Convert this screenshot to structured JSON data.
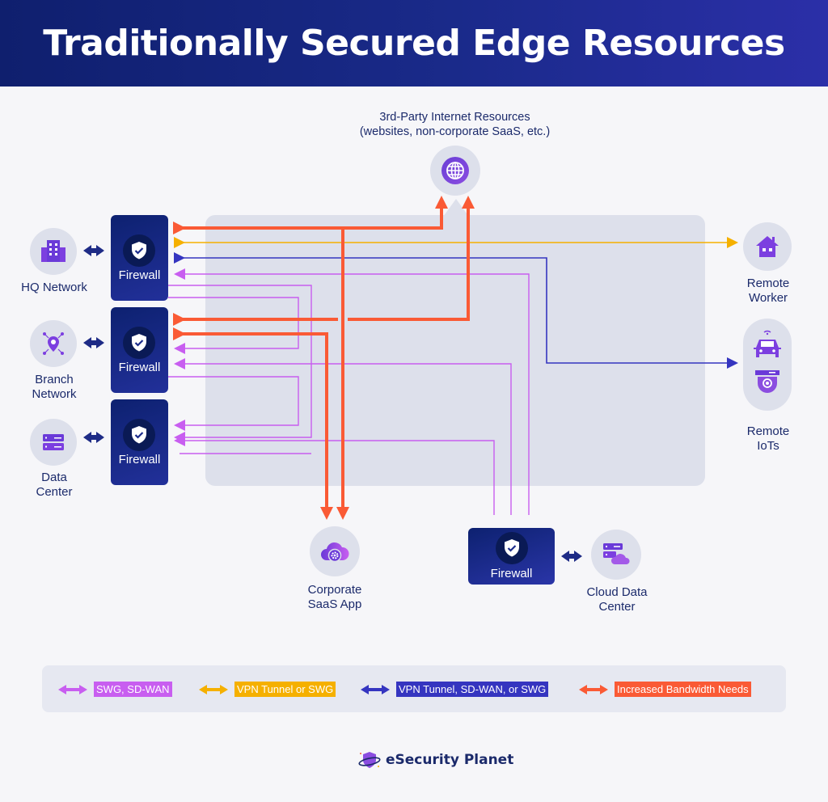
{
  "header": {
    "title": "Traditionally Secured Edge Resources"
  },
  "colors": {
    "swg_sdwan": "#c85ef0",
    "vpn_or_swg": "#f5b000",
    "vpn_sdwan_swg": "#3535c0",
    "increased_bandwidth": "#fa5a35",
    "firewall_bg": "#142584",
    "node_bg": "#dde0eb"
  },
  "internet": {
    "label_line1": "3rd-Party Internet Resources",
    "label_line2": "(websites, non-corporate SaaS, etc.)",
    "icon": "globe-icon"
  },
  "left_sites": [
    {
      "label_line1": "HQ Network",
      "label_line2": "",
      "icon": "building-icon",
      "firewall_label": "Firewall"
    },
    {
      "label_line1": "Branch",
      "label_line2": "Network",
      "icon": "location-network-icon",
      "firewall_label": "Firewall"
    },
    {
      "label_line1": "Data",
      "label_line2": "Center",
      "icon": "server-icon",
      "firewall_label": "Firewall"
    }
  ],
  "remote": [
    {
      "label_line1": "Remote",
      "label_line2": "Worker",
      "icon": "house-icon"
    },
    {
      "label_line1": "Remote",
      "label_line2": "IoTs",
      "icon": "car-camera-icon"
    }
  ],
  "saas": {
    "label_line1": "Corporate",
    "label_line2": "SaaS App",
    "icon": "cloud-gear-icon"
  },
  "cloud_dc": {
    "label_line1": "Cloud Data",
    "label_line2": "Center",
    "icon": "server-cloud-icon",
    "firewall_label": "Firewall"
  },
  "legend": [
    {
      "label": "SWG, SD-WAN",
      "color": "#c85ef0"
    },
    {
      "label": "VPN Tunnel or SWG",
      "color": "#f5b000"
    },
    {
      "label": "VPN Tunnel, SD-WAN, or SWG",
      "color": "#3535c0"
    },
    {
      "label": "Increased Bandwidth Needs",
      "color": "#fa5a35"
    }
  ],
  "brand": {
    "name": "eSecurity Planet"
  }
}
